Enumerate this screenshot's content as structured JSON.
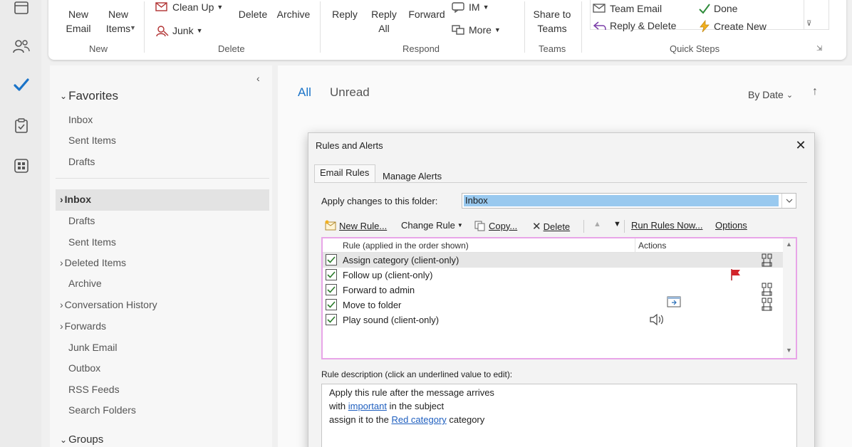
{
  "rail": {
    "icons": [
      "calendar-icon",
      "people-icon",
      "todo-check-icon",
      "clipboard-icon",
      "apps-icon"
    ]
  },
  "ribbon": {
    "new_group": {
      "new_email": "New\nEmail",
      "new_items": "New\nItems",
      "label": "New"
    },
    "delete_group": {
      "clean_up": "Clean Up",
      "junk": "Junk",
      "delete": "Delete",
      "archive": "Archive",
      "label": "Delete"
    },
    "respond_group": {
      "reply": "Reply",
      "reply_all": "Reply\nAll",
      "forward": "Forward",
      "im": "IM",
      "more": "More",
      "label": "Respond"
    },
    "teams_group": {
      "share": "Share to\nTeams",
      "label": "Teams"
    },
    "quick_steps": {
      "team_email": "Team Email",
      "done": "Done",
      "reply_delete": "Reply & Delete",
      "create_new": "Create New",
      "label": "Quick Steps"
    }
  },
  "folders": {
    "favorites_label": "Favorites",
    "favorites": [
      "Inbox",
      "Sent Items",
      "Drafts"
    ],
    "inbox_label": "Inbox",
    "mailbox": [
      {
        "label": "Drafts",
        "expandable": false
      },
      {
        "label": "Sent Items",
        "expandable": false
      },
      {
        "label": "Deleted Items",
        "expandable": true
      },
      {
        "label": "Archive",
        "expandable": false
      },
      {
        "label": "Conversation History",
        "expandable": true
      },
      {
        "label": "Forwards",
        "expandable": true
      },
      {
        "label": "Junk Email",
        "expandable": false
      },
      {
        "label": "Outbox",
        "expandable": false
      },
      {
        "label": "RSS Feeds",
        "expandable": false
      },
      {
        "label": "Search Folders",
        "expandable": false
      }
    ],
    "groups_label": "Groups"
  },
  "message_list": {
    "filter_all": "All",
    "filter_unread": "Unread",
    "sort_label": "By Date"
  },
  "dialog": {
    "title": "Rules and Alerts",
    "tabs": [
      "Email Rules",
      "Manage Alerts"
    ],
    "apply_label": "Apply changes to this folder:",
    "folder_value": "Inbox",
    "toolbar": {
      "new_rule": "New Rule...",
      "change_rule": "Change Rule",
      "copy": "Copy...",
      "delete": "Delete",
      "run_rules": "Run Rules Now...",
      "options": "Options"
    },
    "columns": {
      "rule": "Rule (applied in the order shown)",
      "actions": "Actions"
    },
    "rules": [
      {
        "name": "Assign category  (client-only)",
        "checked": true,
        "selected": true,
        "action_icon": "category-icon"
      },
      {
        "name": "Follow up  (client-only)",
        "checked": true,
        "selected": false,
        "action_icon": "flag-icon"
      },
      {
        "name": "Forward to admin",
        "checked": true,
        "selected": false,
        "action_icon": "forward-rule-icon"
      },
      {
        "name": "Move to folder",
        "checked": true,
        "selected": false,
        "action_icon": "move-folder-icon"
      },
      {
        "name": "Play sound  (client-only)",
        "checked": true,
        "selected": false,
        "action_icon": "sound-icon"
      }
    ],
    "description_label": "Rule description (click an underlined value to edit):",
    "description": {
      "line1": "Apply this rule after the message arrives",
      "line2_prefix": "with ",
      "line2_link": "important",
      "line2_suffix": " in the subject",
      "line3_prefix": "assign it to the ",
      "line3_link": "Red category",
      "line3_suffix": " category"
    }
  },
  "colors": {
    "accent": "#1a73c8",
    "list_border": "#e8a5e8",
    "folder_highlight": "#99c9ef",
    "flag": "#d2232a"
  }
}
